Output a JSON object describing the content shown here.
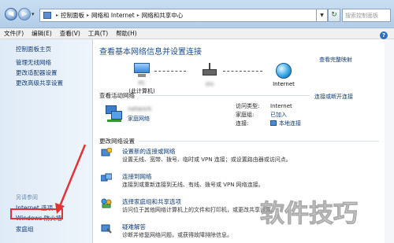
{
  "address_bar": {
    "crumbs": [
      "控制面板",
      "网络和 Internet",
      "网络和共享中心"
    ],
    "search_placeholder": "搜索控制面板"
  },
  "menu": [
    "文件(F)",
    "编辑(E)",
    "查看(V)",
    "工具(T)",
    "帮助(H)"
  ],
  "sidebar": {
    "items": [
      "控制面板主页",
      "管理无线网络",
      "更改适配器设置",
      "更改高级共享设置"
    ],
    "see_also_label": "另请参阅",
    "see_also": [
      "Internet 选项",
      "Windows 防火墙",
      "家庭组"
    ]
  },
  "main": {
    "title": "查看基本网络信息并设置连接",
    "full_map_link": "查看完整映射",
    "map": {
      "computer_label": "(此计算机)",
      "computer_name": "PC",
      "router_name": "sto",
      "internet_label": "Internet"
    },
    "active_title": "查看活动网络",
    "disconnect_link": "连接或断开连接",
    "network": {
      "name": "network",
      "type_link": "家庭网络"
    },
    "properties": [
      {
        "label": "访问类型:",
        "value": "Internet",
        "link": false
      },
      {
        "label": "家庭组:",
        "value": "已加入",
        "link": true
      },
      {
        "label": "连接:",
        "value": "本地连接",
        "link": true
      }
    ],
    "change_title": "更改网络设置",
    "tasks": [
      {
        "link": "设置新的连接或网络",
        "desc": "设置无线、宽带、拨号、临时或 VPN 连接；或设置路由器或访问点。",
        "icon": "new-connection-icon"
      },
      {
        "link": "连接到网络",
        "desc": "连接到或重新连接到无线、有线、拨号或 VPN 网络连接。",
        "icon": "connect-network-icon"
      },
      {
        "link": "选择家庭组和共享选项",
        "desc": "访问位于其他网络计算机上的文件和打印机，或更改共享设置。",
        "icon": "homegroup-icon"
      },
      {
        "link": "疑难解答",
        "desc": "诊断并修复网络问题，或获得故障排除信息。",
        "icon": "troubleshoot-icon"
      }
    ]
  },
  "watermark": "软件技巧",
  "colors": {
    "accent_link": "#123b7a",
    "title_blue": "#1b4e94",
    "highlight_red": "#e53237"
  }
}
